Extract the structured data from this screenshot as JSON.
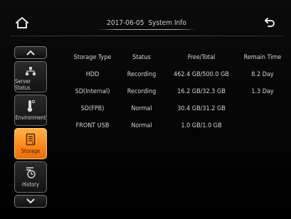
{
  "header": {
    "date": "2017-06-05",
    "title": "System Info"
  },
  "sidebar": {
    "items": [
      {
        "label": "Server Status",
        "icon": "network-icon"
      },
      {
        "label": "Environment",
        "icon": "thermometer-icon"
      },
      {
        "label": "Storage",
        "icon": "storage-icon",
        "active": true
      },
      {
        "label": "History",
        "icon": "history-icon"
      }
    ]
  },
  "table": {
    "headers": [
      "Storage Type",
      "Status",
      "Free/Total",
      "Remain Time"
    ],
    "rows": [
      [
        "HDD",
        "Recording",
        "462.4 GB/500.0 GB",
        "8.2 Day"
      ],
      [
        "SD(Internal)",
        "Recording",
        "16.2 GB/32.3 GB",
        "1.3 Day"
      ],
      [
        "SD(FPB)",
        "Normal",
        "30.4 GB/31.2 GB",
        ""
      ],
      [
        "FRONT USB",
        "Normal",
        "1.0 GB/1.0 GB",
        ""
      ]
    ]
  },
  "colors": {
    "accent": "#ff9a2e",
    "background": "#000000",
    "text": "#d6d6d6"
  }
}
